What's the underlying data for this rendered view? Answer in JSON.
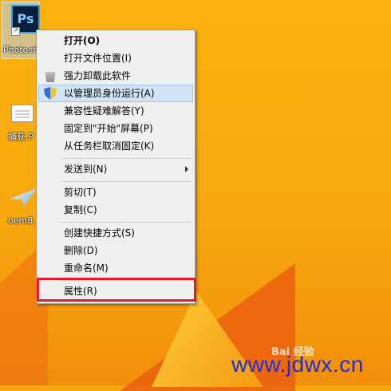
{
  "desktop": {
    "icons": [
      {
        "label": "Photosh",
        "name": "Photoshop"
      },
      {
        "label": "捕获.P",
        "name": "capture"
      },
      {
        "label": "oem8.",
        "name": "oem8"
      }
    ]
  },
  "context_menu": {
    "items": [
      {
        "label": "打开(O)",
        "bold": true
      },
      {
        "label": "打开文件位置(I)"
      },
      {
        "label": "强力卸载此软件",
        "icon": "trash-icon"
      },
      {
        "label": "以管理员身份运行(A)",
        "icon": "shield-icon",
        "highlighted": true
      },
      {
        "label": "兼容性疑难解答(Y)"
      },
      {
        "label": "固定到\"开始\"屏幕(P)"
      },
      {
        "label": "从任务栏取消固定(K)"
      },
      {
        "label": "发送到(N)",
        "submenu": true
      },
      {
        "label": "剪切(T)"
      },
      {
        "label": "复制(C)"
      },
      {
        "label": "创建快捷方式(S)"
      },
      {
        "label": "删除(D)"
      },
      {
        "label": "重命名(M)"
      },
      {
        "label": "属性(R)",
        "boxed": true
      }
    ]
  },
  "watermark": {
    "brand": "Bai 经验",
    "url": "www.jdwx.cn"
  },
  "colors": {
    "highlight_red": "#e21d28",
    "watermark_blue": "#1c2fd8",
    "desktop_orange": "#f7a70f"
  }
}
